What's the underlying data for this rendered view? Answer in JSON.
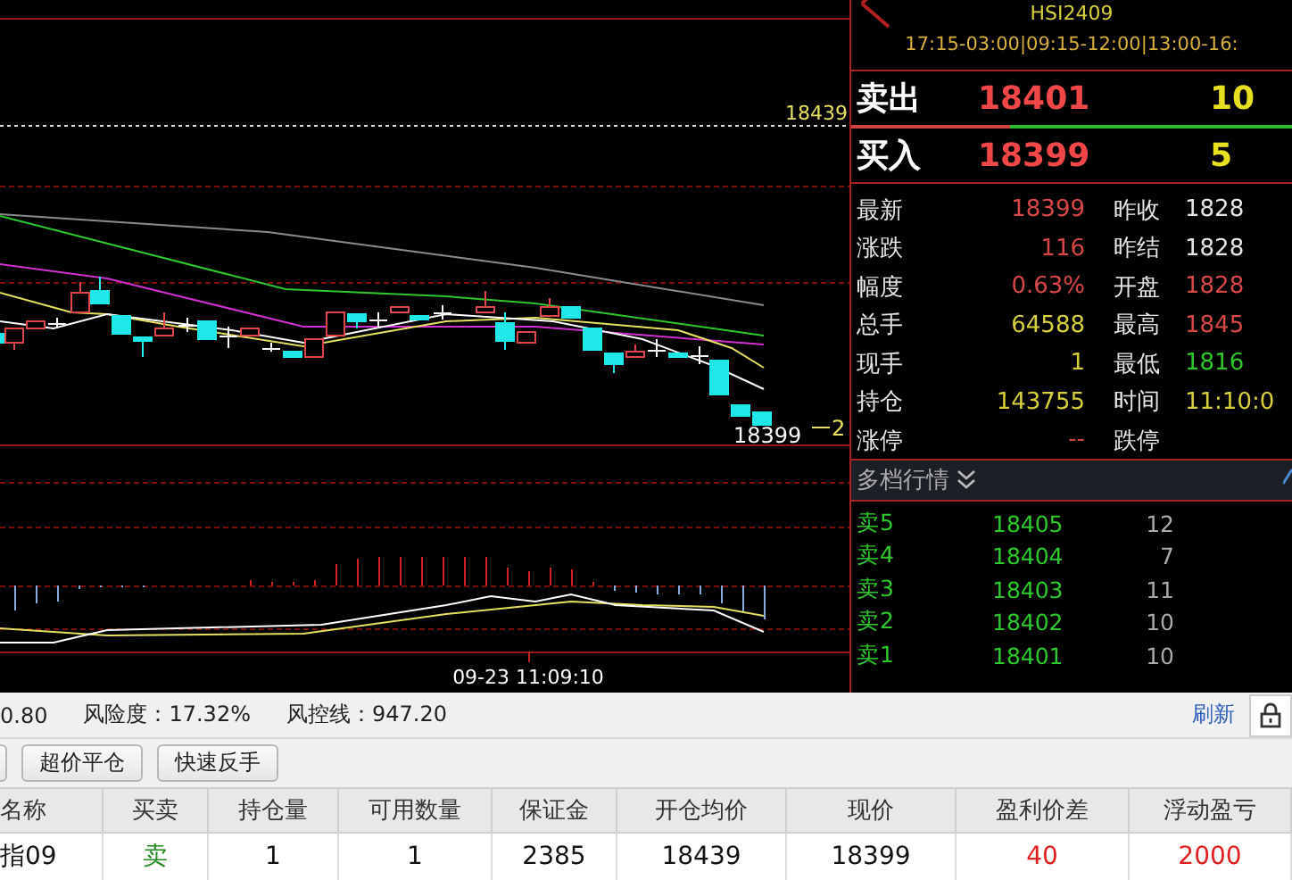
{
  "chart": {
    "price_line_label": "18439",
    "last_price_label": "18399",
    "position_marker": "2",
    "crosshair_time": "09-23 11:09:10"
  },
  "quote": {
    "symbol": "HSI2409",
    "sessions": "17:15-03:00|09:15-12:00|13:00-16:",
    "ask": {
      "label": "卖出",
      "price": "18401",
      "volume": "10"
    },
    "bid": {
      "label": "买入",
      "price": "18399",
      "volume": "5"
    },
    "ratio_bar": {
      "level": 0.36
    },
    "stats": [
      {
        "label": "最新",
        "value": "18399",
        "color": "#d84848"
      },
      {
        "label": "昨收",
        "value": "1828",
        "color": "#e6e6e6"
      },
      {
        "label": "涨跌",
        "value": "116",
        "color": "#d84848"
      },
      {
        "label": "昨结",
        "value": "1828",
        "color": "#e6e6e6"
      },
      {
        "label": "幅度",
        "value": "0.63%",
        "color": "#d84848"
      },
      {
        "label": "开盘",
        "value": "1828",
        "color": "#d84848"
      },
      {
        "label": "总手",
        "value": "64588",
        "color": "#d6d03a"
      },
      {
        "label": "最高",
        "value": "1845",
        "color": "#d84848"
      },
      {
        "label": "现手",
        "value": "1",
        "color": "#d6d03a"
      },
      {
        "label": "最低",
        "value": "1816",
        "color": "#2ec82e"
      },
      {
        "label": "持仓",
        "value": "143755",
        "color": "#d6d03a"
      },
      {
        "label": "时间",
        "value": "11:10:0",
        "color": "#d6d03a"
      },
      {
        "label": "涨停",
        "value": "--",
        "color": "#d84848"
      },
      {
        "label": "跌停"
      }
    ],
    "depth_header": "多档行情",
    "depth": [
      {
        "label": "卖5",
        "price": "18405",
        "volume": "12"
      },
      {
        "label": "卖4",
        "price": "18404",
        "volume": "7"
      },
      {
        "label": "卖3",
        "price": "18403",
        "volume": "11"
      },
      {
        "label": "卖2",
        "price": "18402",
        "volume": "10"
      },
      {
        "label": "卖1",
        "price": "18401",
        "volume": "10"
      }
    ]
  },
  "account": {
    "balance_fragment": "0.80",
    "risk_level": "风险度：17.32%",
    "risk_line": "风控线：947.20",
    "refresh": "刷新"
  },
  "buttons": [
    "超价平仓",
    "快速反手"
  ],
  "positions": {
    "columns": [
      "名称",
      "买卖",
      "持仓量",
      "可用数量",
      "保证金",
      "开仓均价",
      "现价",
      "盈利价差",
      "浮动盈亏"
    ],
    "rows": [
      {
        "cells": [
          {
            "text": "指09"
          },
          {
            "text": "卖",
            "color": "#208a20"
          },
          {
            "text": "1"
          },
          {
            "text": "1"
          },
          {
            "text": "2385"
          },
          {
            "text": "18439"
          },
          {
            "text": "18399"
          },
          {
            "text": "40",
            "color": "#e02020"
          },
          {
            "text": "2000",
            "color": "#e02020"
          }
        ]
      }
    ]
  }
}
